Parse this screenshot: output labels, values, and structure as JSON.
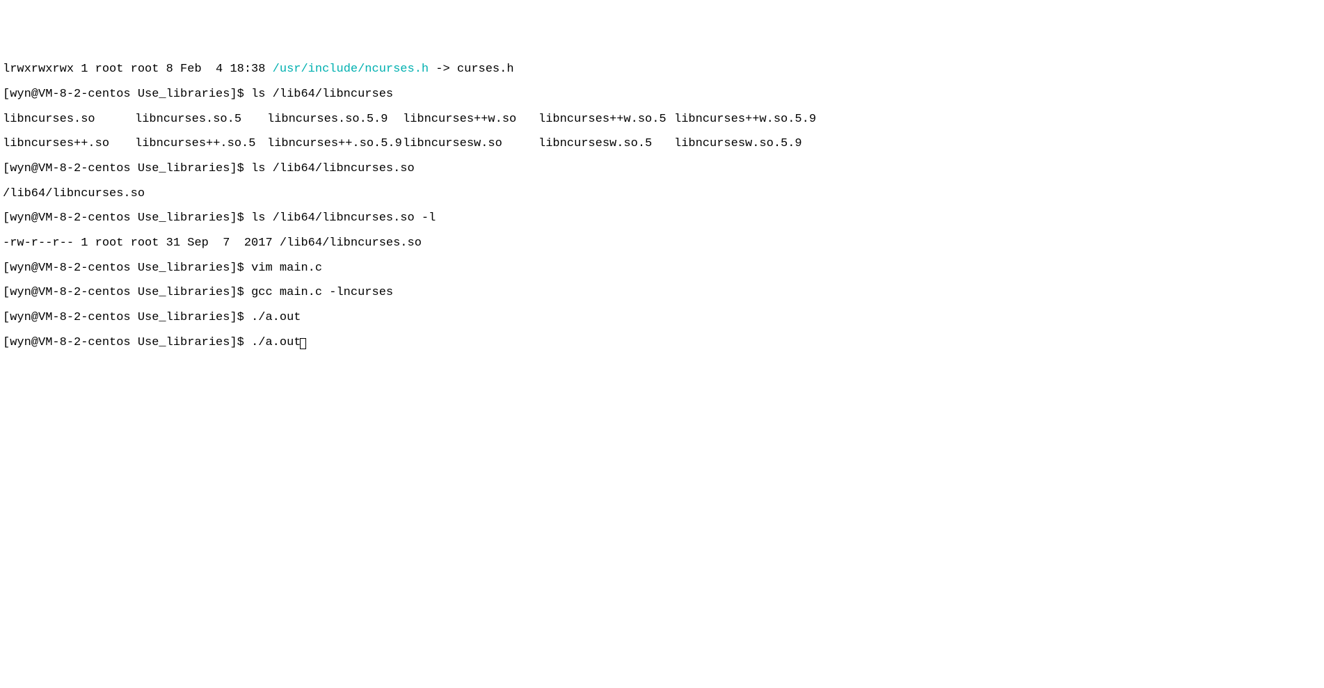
{
  "lines": {
    "line0_pre": "lrwxrwxrwx 1 root root 8 Feb  4 18:38 ",
    "line0_link": "/usr/include/ncurses.h",
    "line0_post": " -> curses.h",
    "prompt": "[wyn@VM-8-2-centos Use_libraries]$ ",
    "cmd1": "ls /lib64/libncurses",
    "listing": {
      "r1c1": "libncurses.so",
      "r1c2": "libncurses.so.5",
      "r1c3": "libncurses.so.5.9",
      "r1c4": "libncurses++w.so",
      "r1c5": "libncurses++w.so.5",
      "r1c6": "libncurses++w.so.5.9",
      "r2c1": "libncurses++.so",
      "r2c2": "libncurses++.so.5",
      "r2c3": "libncurses++.so.5.9",
      "r2c4": "libncursesw.so",
      "r2c5": "libncursesw.so.5",
      "r2c6": "libncursesw.so.5.9"
    },
    "cmd2": "ls /lib64/libncurses.so",
    "out2": "/lib64/libncurses.so",
    "cmd3": "ls /lib64/libncurses.so -l",
    "out3": "-rw-r--r-- 1 root root 31 Sep  7  2017 /lib64/libncurses.so",
    "cmd4": "vim main.c",
    "cmd5": "gcc main.c -lncurses",
    "cmd6": "./a.out",
    "cmd7": "./a.out"
  }
}
